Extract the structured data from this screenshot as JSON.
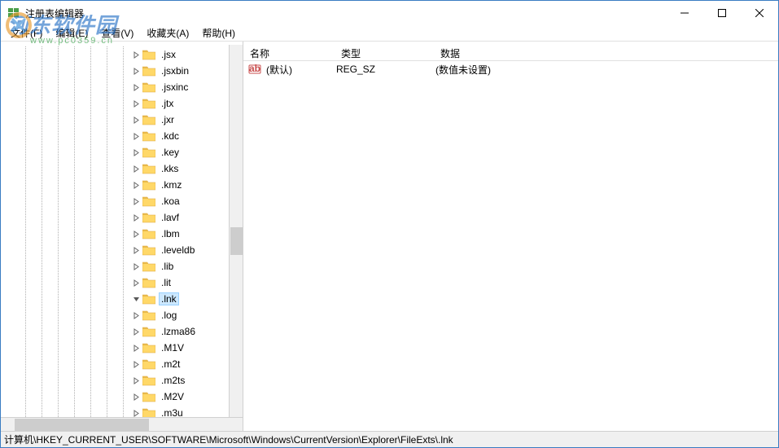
{
  "window": {
    "title": "注册表编辑器"
  },
  "menu": {
    "file": "文件(F)",
    "edit": "编辑(E)",
    "view": "查看(V)",
    "favorites": "收藏夹(A)",
    "help": "帮助(H)"
  },
  "tree": {
    "items": [
      {
        "label": ".jsx",
        "selected": false
      },
      {
        "label": ".jsxbin",
        "selected": false
      },
      {
        "label": ".jsxinc",
        "selected": false
      },
      {
        "label": ".jtx",
        "selected": false
      },
      {
        "label": ".jxr",
        "selected": false
      },
      {
        "label": ".kdc",
        "selected": false
      },
      {
        "label": ".key",
        "selected": false
      },
      {
        "label": ".kks",
        "selected": false
      },
      {
        "label": ".kmz",
        "selected": false
      },
      {
        "label": ".koa",
        "selected": false
      },
      {
        "label": ".lavf",
        "selected": false
      },
      {
        "label": ".lbm",
        "selected": false
      },
      {
        "label": ".leveldb",
        "selected": false
      },
      {
        "label": ".lib",
        "selected": false
      },
      {
        "label": ".lit",
        "selected": false
      },
      {
        "label": ".lnk",
        "selected": true
      },
      {
        "label": ".log",
        "selected": false
      },
      {
        "label": ".lzma86",
        "selected": false
      },
      {
        "label": ".M1V",
        "selected": false
      },
      {
        "label": ".m2t",
        "selected": false
      },
      {
        "label": ".m2ts",
        "selected": false
      },
      {
        "label": ".M2V",
        "selected": false
      },
      {
        "label": ".m3u",
        "selected": false
      }
    ]
  },
  "list": {
    "columns": {
      "name": "名称",
      "type": "类型",
      "data": "数据"
    },
    "rows": [
      {
        "name": "(默认)",
        "type": "REG_SZ",
        "data": "(数值未设置)"
      }
    ]
  },
  "statusbar": {
    "path": "计算机\\HKEY_CURRENT_USER\\SOFTWARE\\Microsoft\\Windows\\CurrentVersion\\Explorer\\FileExts\\.lnk"
  },
  "watermark": {
    "text1": "河东软件园",
    "text2": "www.pc0359.cn"
  }
}
